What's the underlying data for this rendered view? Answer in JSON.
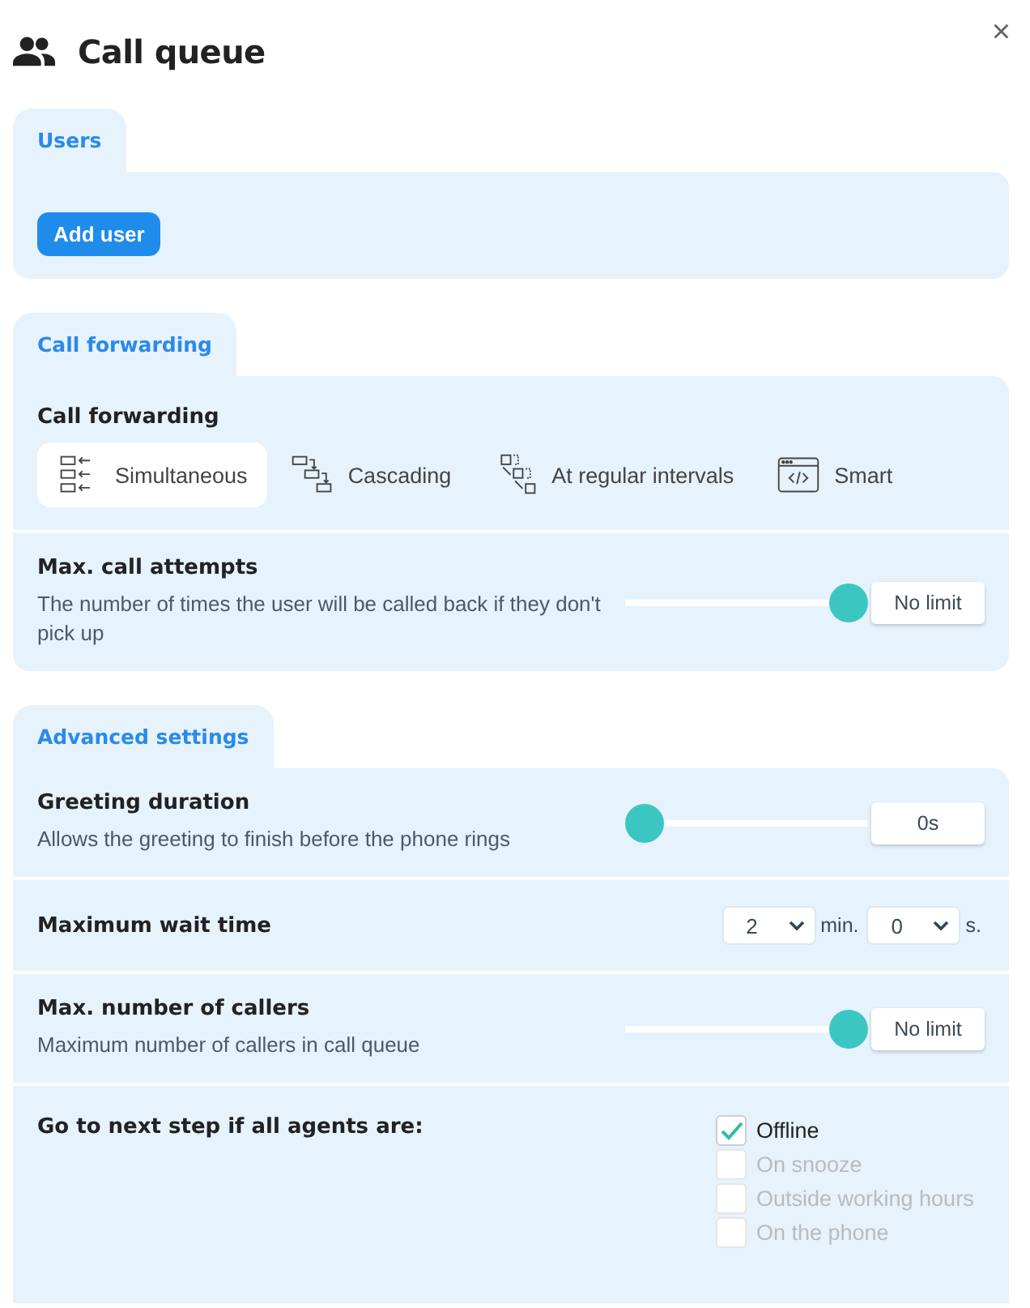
{
  "window": {
    "title": "Call queue",
    "close": "×"
  },
  "users": {
    "tab": "Users",
    "add_button": "Add user"
  },
  "forwarding": {
    "tab": "Call forwarding",
    "heading": "Call forwarding",
    "options": [
      {
        "label": "Simultaneous",
        "selected": true
      },
      {
        "label": "Cascading",
        "selected": false
      },
      {
        "label": "At regular intervals",
        "selected": false
      },
      {
        "label": "Smart",
        "selected": false
      }
    ],
    "attempts": {
      "label": "Max. call attempts",
      "description": "The number of times the user will be called back if they don't pick up",
      "level": 1,
      "value": "No limit"
    }
  },
  "advanced": {
    "tab": "Advanced settings",
    "greeting": {
      "label": "Greeting duration",
      "description": "Allows the greeting to finish before the phone rings",
      "level": 0,
      "value": "0s"
    },
    "wait": {
      "label": "Maximum wait time",
      "minutes": "2",
      "minutes_unit": "min.",
      "seconds": "0",
      "seconds_unit": "s."
    },
    "callers": {
      "label": "Max. number of callers",
      "description": "Maximum number of callers in call queue",
      "level": 1,
      "value": "No limit"
    },
    "next_step": {
      "label": "Go to next step if all agents are:",
      "options": [
        {
          "label": "Offline",
          "checked": true,
          "disabled": false
        },
        {
          "label": "On snooze",
          "checked": false,
          "disabled": true
        },
        {
          "label": "Outside working hours",
          "checked": false,
          "disabled": true
        },
        {
          "label": "On the phone",
          "checked": false,
          "disabled": true
        }
      ]
    }
  }
}
